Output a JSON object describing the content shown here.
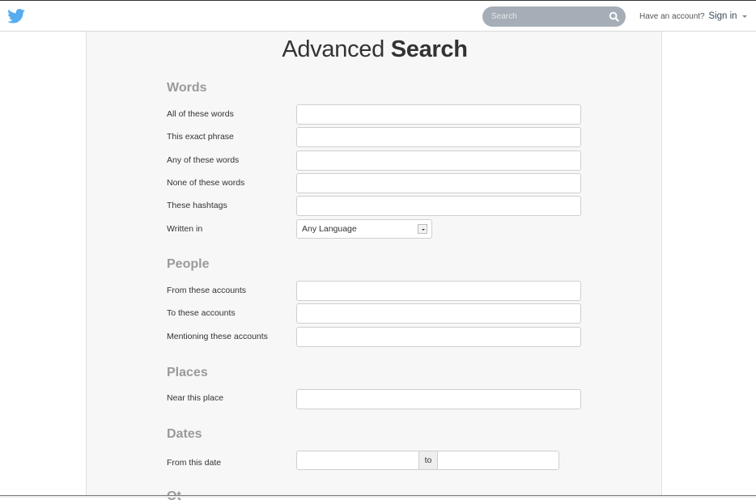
{
  "topbar": {
    "logo": "twitter-bird-icon",
    "brand_color": "#55acee",
    "search": {
      "placeholder": "Search",
      "value": "",
      "icon": "search-icon"
    },
    "account_prompt": "Have an account?",
    "sign_in_label": "Sign in"
  },
  "page": {
    "title_light": "Advanced",
    "title_bold": "Search"
  },
  "sections": {
    "words": {
      "heading": "Words",
      "all_words": {
        "label": "All of these words",
        "value": ""
      },
      "exact_phrase": {
        "label": "This exact phrase",
        "value": ""
      },
      "any_words": {
        "label": "Any of these words",
        "value": ""
      },
      "none_words": {
        "label": "None of these words",
        "value": ""
      },
      "hashtags": {
        "label": "These hashtags",
        "value": ""
      },
      "written_in": {
        "label": "Written in",
        "selected": "Any Language"
      }
    },
    "people": {
      "heading": "People",
      "from_accounts": {
        "label": "From these accounts",
        "value": ""
      },
      "to_accounts": {
        "label": "To these accounts",
        "value": ""
      },
      "mentioning": {
        "label": "Mentioning these accounts",
        "value": ""
      }
    },
    "places": {
      "heading": "Places",
      "near_place": {
        "label": "Near this place",
        "value": ""
      }
    },
    "dates": {
      "heading": "Dates",
      "from_date": {
        "label": "From this date",
        "from_value": "",
        "to_value": ""
      },
      "to_separator": "to"
    },
    "next_heading_partial": "Ot"
  }
}
